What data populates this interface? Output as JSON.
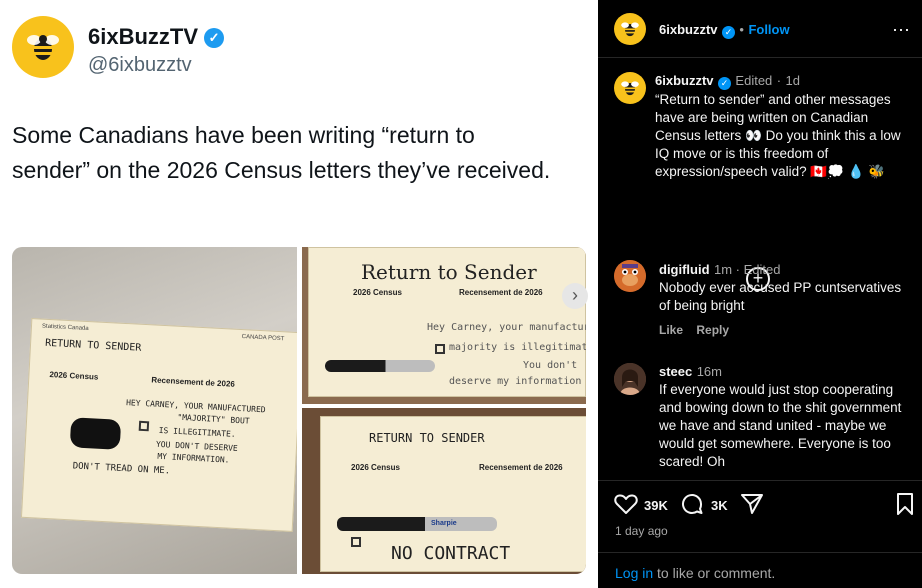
{
  "tweet": {
    "name": "6ixBuzzTV",
    "handle": "@6ixbuzztv",
    "text": "Some Canadians have been writing “return to sender” on the 2026 Census letters they’ve received."
  },
  "photos": {
    "p1": {
      "header_left": "Statistics Canada",
      "header_right": "CANADA POST",
      "return": "RETURN TO SENDER",
      "census_en": "2026 Census",
      "census_fr": "Recensement de 2026",
      "line1": "HEY CARNEY, YOUR MANUFACTURED",
      "line2": "\"MAJORITY\" BOUT",
      "line3": "IS ILLEGITIMATE.",
      "line4": "YOU DON'T DESERVE",
      "line5": "MY INFORMATION.",
      "line6": "DON'T TREAD ON ME."
    },
    "p2": {
      "title": "Return to Sender",
      "census_en": "2026 Census",
      "census_fr": "Recensement de 2026",
      "line1": "Hey Carney, your manufactured",
      "line2": "majority is illegitimate!",
      "line3": "You don't",
      "line4": "deserve my information"
    },
    "p3": {
      "title": "RETURN TO SENDER",
      "census_en": "2026 Census",
      "census_fr": "Recensement de 2026",
      "marker": "Sharpie",
      "line1": "NO CONTRACT"
    }
  },
  "threads": {
    "header": {
      "username": "6ixbuzztv",
      "follow": "Follow",
      "sep": "•"
    },
    "post": {
      "username": "6ixbuzztv",
      "edited": "Edited",
      "dot": "·",
      "time": "1d",
      "text": "“Return to sender” and other messages have are being written on Canadian Census letters 👀 Do you think this a low IQ move or is this freedom of expression/speech valid? 🇨🇦💭 💧 🐝"
    },
    "comments": [
      {
        "username": "digifluid",
        "time": "1m",
        "edited": "Edited",
        "text": "Nobody ever accused PP cuntservatives of being bright",
        "like": "Like",
        "reply": "Reply"
      },
      {
        "username": "steec",
        "time": "16m",
        "text": "If everyone would just stop cooperating and bowing down to the shit government we have and stand united - maybe we would get somewhere. Everyone is too scared! Oh"
      }
    ],
    "actions": {
      "likes": "39K",
      "comments": "3K",
      "time": "1 day ago",
      "login": "Log in",
      "login_rest": "to like or comment."
    },
    "colors": {
      "link": "#0095f6",
      "verified": "#0095f6",
      "bg": "#000000"
    }
  }
}
